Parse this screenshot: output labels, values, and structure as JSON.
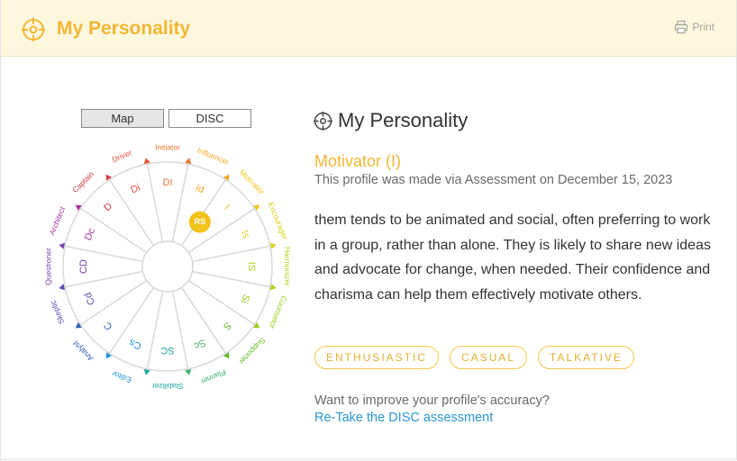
{
  "header": {
    "title": "My Personality",
    "print_label": "Print"
  },
  "toggle": {
    "map_label": "Map",
    "disc_label": "DISC"
  },
  "section": {
    "title": "My Personality",
    "type_label": "Motivator (I)",
    "meta": "This profile was made via Assessment on December 15, 2023",
    "description": "them tends to be animated and social, often preferring to work in a group, rather than alone. They is likely to share new ideas and advocate for change, when needed. Their confidence and charisma can help them effectively motivate others."
  },
  "tags": [
    "ENTHUSIASTIC",
    "CASUAL",
    "TALKATIVE"
  ],
  "improve": {
    "question": "Want to improve your profile's accuracy?",
    "link": "Re-Take the DISC assessment"
  },
  "wheel": {
    "marker": "RS",
    "marker_segment": 2,
    "segments": [
      {
        "inner": "DI",
        "outer": "Initiator",
        "color": "#e8732d"
      },
      {
        "inner": "Id",
        "outer": "Influencer",
        "color": "#f5a623"
      },
      {
        "inner": "I",
        "outer": "Motivator",
        "color": "#f0c419"
      },
      {
        "inner": "Is",
        "outer": "Encourager",
        "color": "#d9cf1b"
      },
      {
        "inner": "IS",
        "outer": "Harmonizer",
        "color": "#b9cf1f"
      },
      {
        "inner": "Si",
        "outer": "Counselor",
        "color": "#9ccc1c"
      },
      {
        "inner": "S",
        "outer": "Supporter",
        "color": "#62b62a"
      },
      {
        "inner": "Sc",
        "outer": "Planner",
        "color": "#3cae6a"
      },
      {
        "inner": "SC",
        "outer": "Stabilizer",
        "color": "#1aa59e"
      },
      {
        "inner": "Cs",
        "outer": "Editor",
        "color": "#1b8fcf"
      },
      {
        "inner": "C",
        "outer": "Analyst",
        "color": "#2f5fb6"
      },
      {
        "inner": "Cd",
        "outer": "Skeptic",
        "color": "#5a4bb0"
      },
      {
        "inner": "CD",
        "outer": "Questioner",
        "color": "#7b3fab"
      },
      {
        "inner": "Dc",
        "outer": "Architect",
        "color": "#a3339b"
      },
      {
        "inner": "D",
        "outer": "Captain",
        "color": "#d83a4a"
      },
      {
        "inner": "Di",
        "outer": "Driver",
        "color": "#e5503a"
      }
    ]
  },
  "colors": {
    "accent": "#f2b635",
    "header_bg": "#fdf7dd",
    "link": "#2a95d6",
    "tag_border": "#f2c94c"
  }
}
